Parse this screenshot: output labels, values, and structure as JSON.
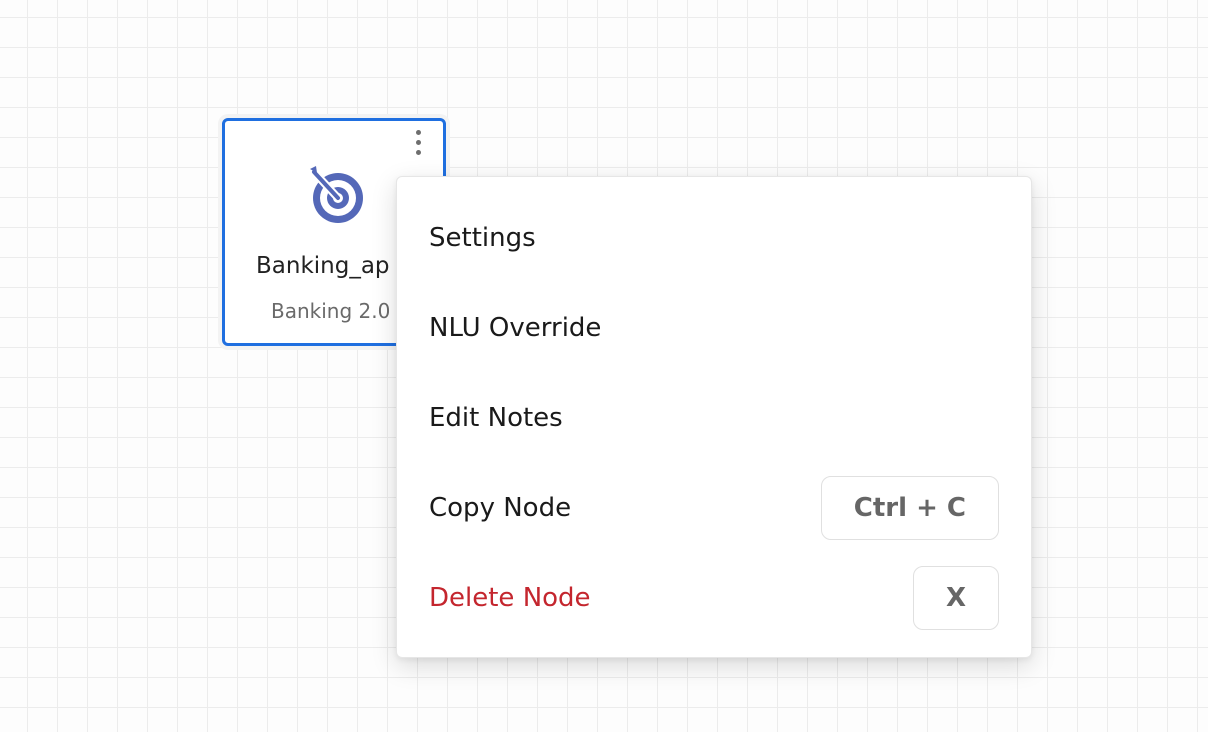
{
  "node": {
    "title": "Banking_ap",
    "subtitle": "Banking 2.0",
    "icon": "target-icon",
    "more_icon": "more-vertical-icon",
    "selected": true,
    "accent_color": "#1f6fe0",
    "icon_color": "#5468b8"
  },
  "context_menu": {
    "items": [
      {
        "label": "Settings",
        "shortcut": ""
      },
      {
        "label": "NLU Override",
        "shortcut": ""
      },
      {
        "label": "Edit Notes",
        "shortcut": ""
      },
      {
        "label": "Copy Node",
        "shortcut": "Ctrl + C"
      },
      {
        "label": "Delete Node",
        "shortcut": "X",
        "danger_color": "#c4262e"
      }
    ]
  }
}
